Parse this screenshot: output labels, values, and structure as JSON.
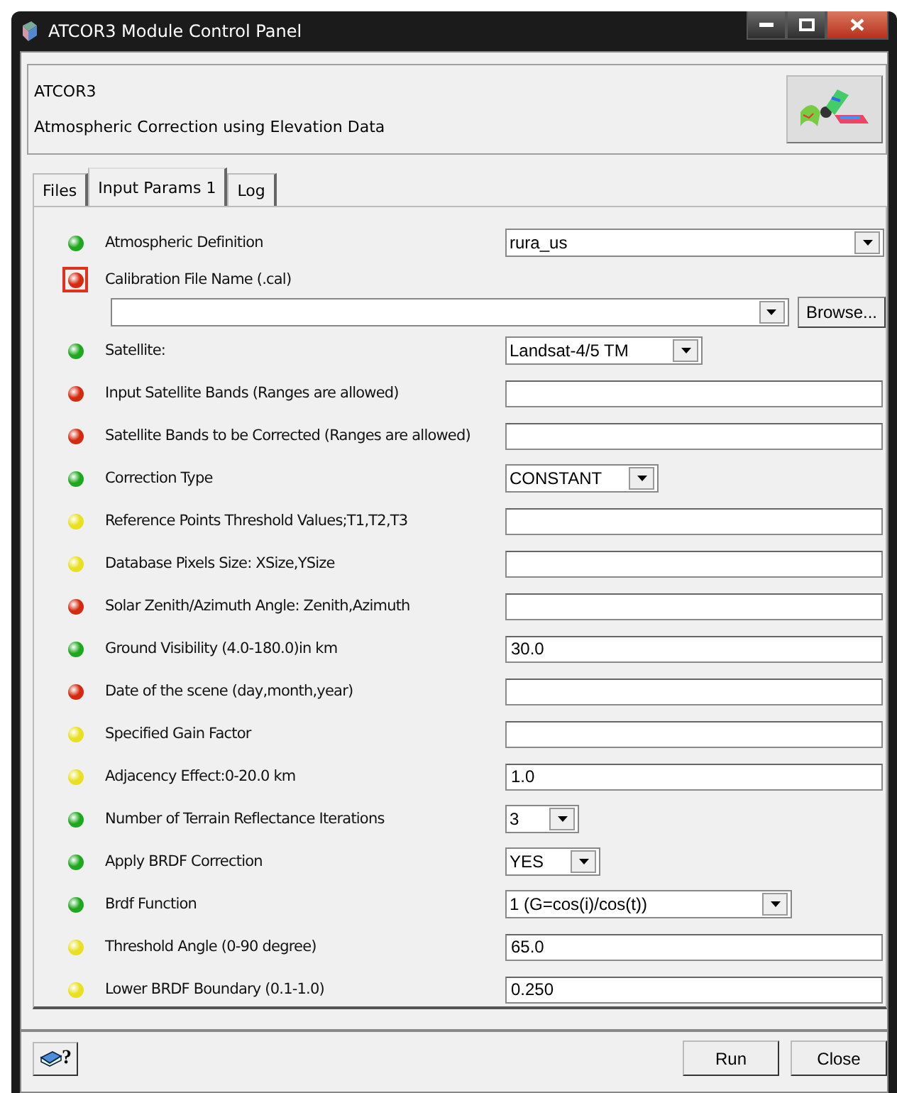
{
  "window": {
    "title": "ATCOR3 Module Control Panel"
  },
  "header": {
    "title": "ATCOR3",
    "subtitle": "Atmospheric Correction using Elevation Data"
  },
  "tabs": [
    {
      "label": "Files",
      "selected": false
    },
    {
      "label": "Input Params 1",
      "selected": true
    },
    {
      "label": "Log",
      "selected": false
    }
  ],
  "params": [
    {
      "label": "Atmospheric Definition",
      "color": "#1fa81f",
      "kind": "select",
      "value": "rura_us",
      "focused": false
    },
    {
      "label": "Calibration File Name (.cal)",
      "color": "#d42a10",
      "kind": "file",
      "button": "Browse...",
      "focused": true
    },
    {
      "label": "Satellite:",
      "color": "#1fa81f",
      "kind": "select",
      "value": "Landsat-4/5 TM",
      "focused": false
    },
    {
      "label": "Input Satellite Bands (Ranges are allowed)",
      "color": "#d42a10",
      "kind": "text",
      "focused": false
    },
    {
      "label": "Satellite Bands to be Corrected (Ranges are allowed)",
      "color": "#d42a10",
      "kind": "text",
      "focused": false
    },
    {
      "label": "Correction Type",
      "color": "#1fa81f",
      "kind": "select",
      "value": "CONSTANT",
      "focused": false
    },
    {
      "label": "Reference Points Threshold Values;T1,T2,T3",
      "color": "#e8e020",
      "kind": "text",
      "focused": false
    },
    {
      "label": "Database Pixels Size: XSize,YSize",
      "color": "#e8e020",
      "kind": "text",
      "focused": false
    },
    {
      "label": "Solar Zenith/Azimuth  Angle: Zenith,Azimuth",
      "color": "#d42a10",
      "kind": "text",
      "focused": false
    },
    {
      "label": "Ground Visibility (4.0-180.0)in  km",
      "color": "#1fa81f",
      "kind": "text",
      "value": "30.0",
      "focused": false
    },
    {
      "label": "Date of the scene (day,month,year)",
      "color": "#d42a10",
      "kind": "text",
      "focused": false
    },
    {
      "label": "Specified Gain Factor",
      "color": "#e8e020",
      "kind": "text",
      "focused": false
    },
    {
      "label": "Adjacency Effect:0-20.0 km",
      "color": "#e8e020",
      "kind": "text",
      "value": "1.0",
      "focused": false
    },
    {
      "label": "Number of Terrain Reflectance Iterations",
      "color": "#1fa81f",
      "kind": "select",
      "value": "3",
      "focused": false
    },
    {
      "label": "Apply BRDF Correction",
      "color": "#1fa81f",
      "kind": "select",
      "value": "YES",
      "focused": false
    },
    {
      "label": "Brdf Function",
      "color": "#1fa81f",
      "kind": "select",
      "value": "1  (G=cos(i)/cos(t))",
      "focused": false
    },
    {
      "label": "Threshold Angle (0-90 degree)",
      "color": "#e8e020",
      "kind": "text",
      "value": "65.0",
      "focused": false
    },
    {
      "label": "Lower BRDF Boundary (0.1-1.0)",
      "color": "#e8e020",
      "kind": "text",
      "value": "0.250",
      "focused": false
    }
  ],
  "footer": {
    "help": "?",
    "buttons": [
      "Run",
      "Close"
    ]
  }
}
